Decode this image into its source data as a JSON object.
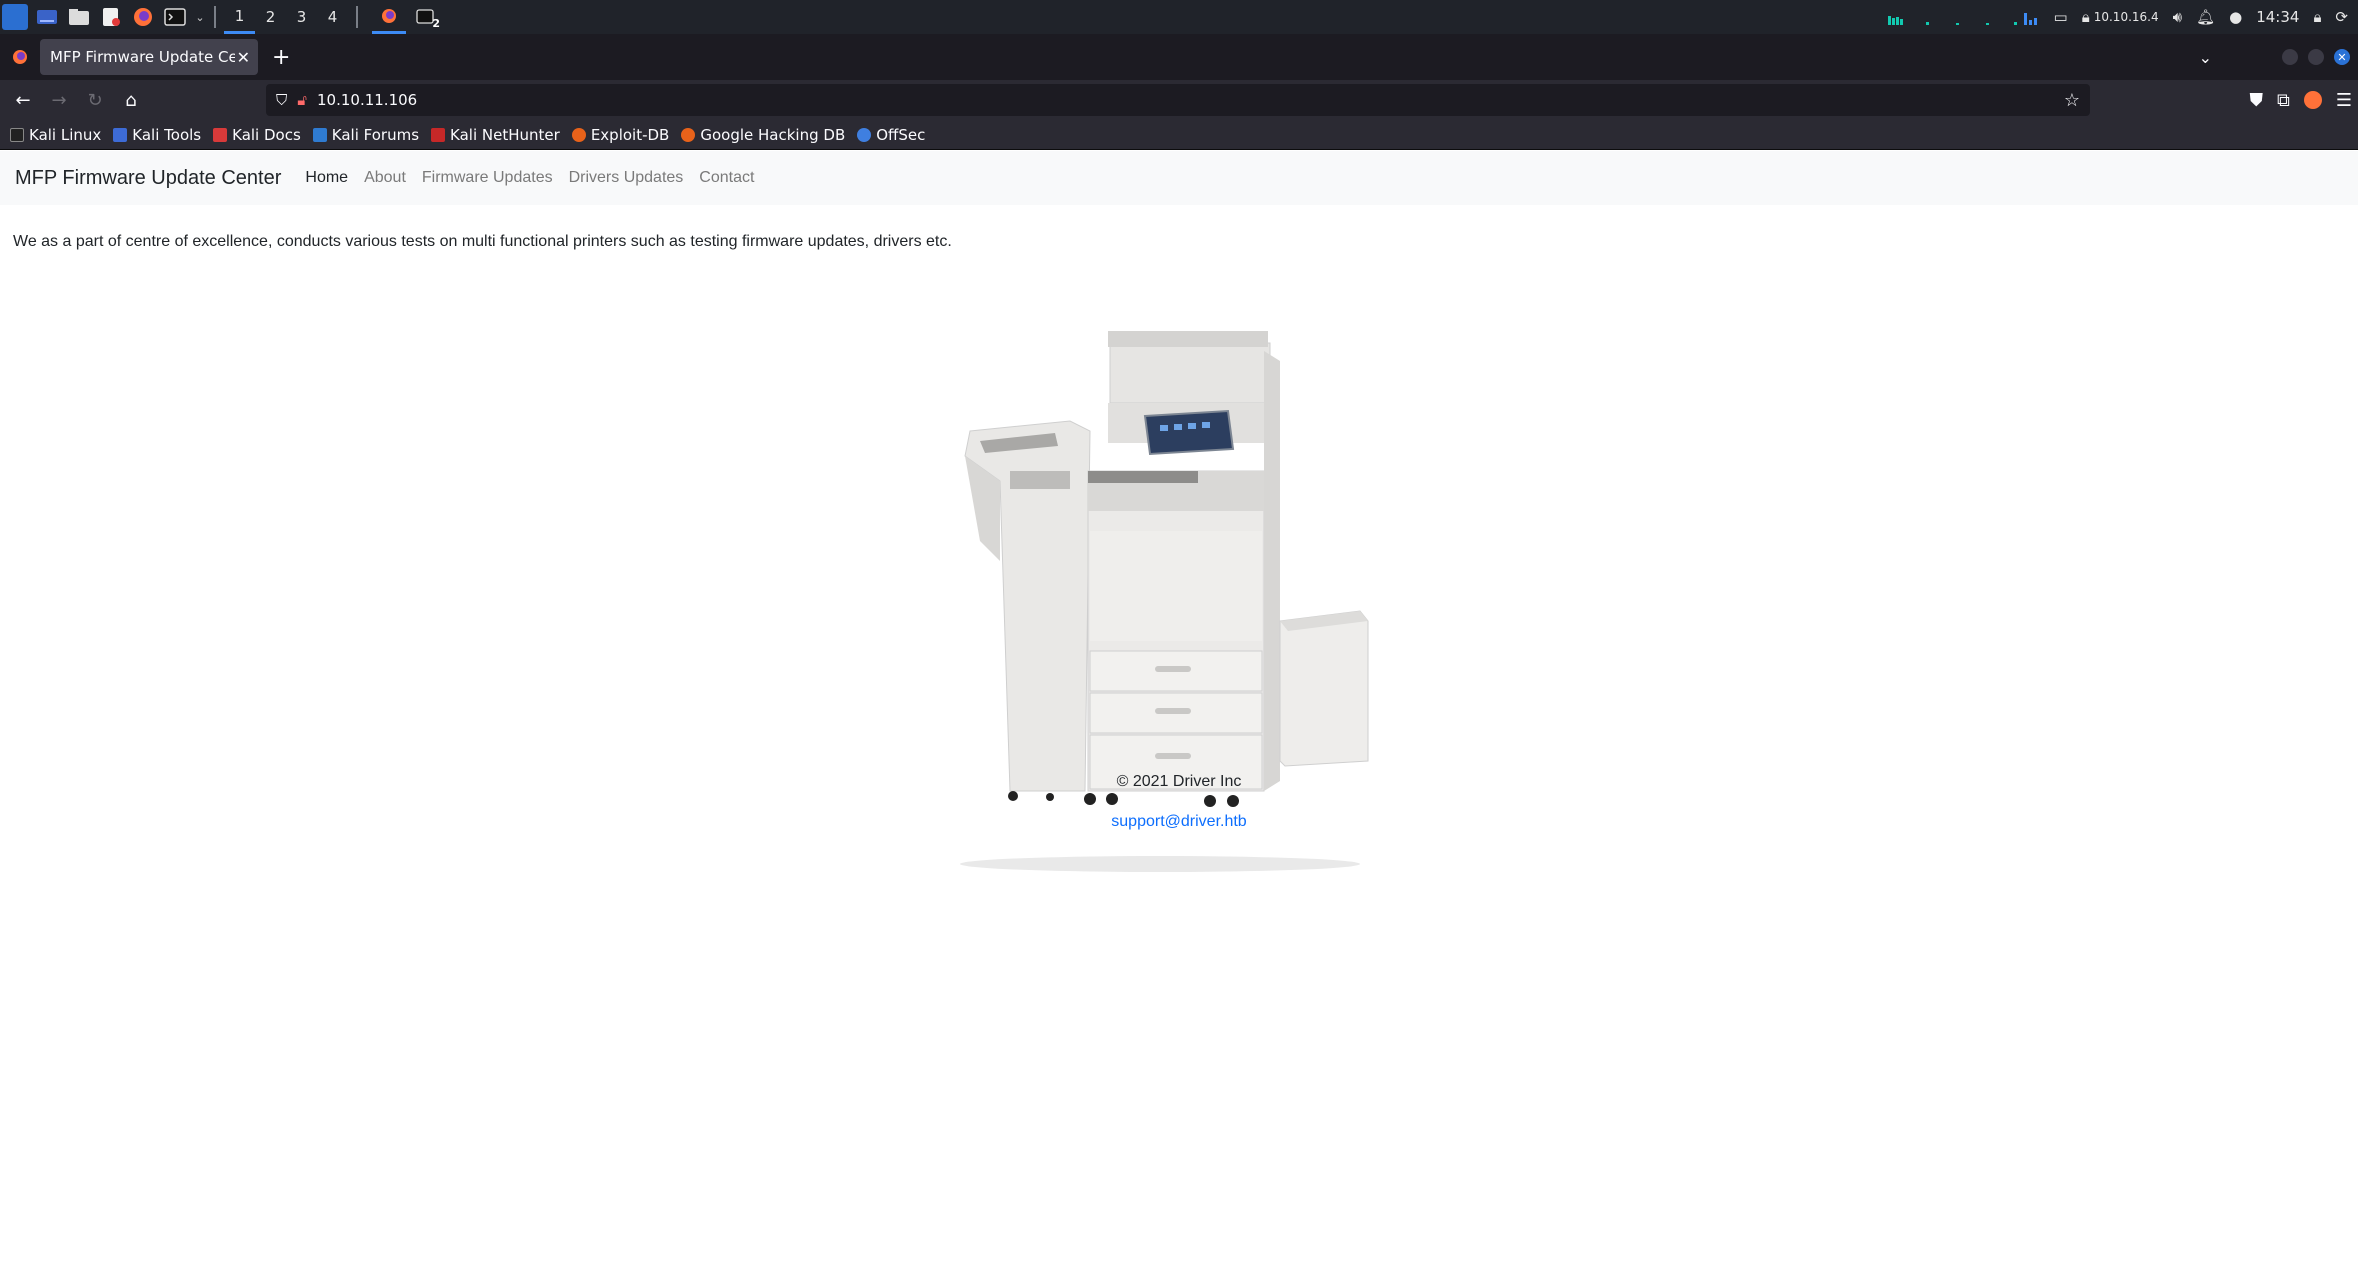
{
  "taskbar": {
    "workspaces": [
      "1",
      "2",
      "3",
      "4"
    ],
    "terminal_badge": "2",
    "ip": "10.10.16.4",
    "clock": "14:34"
  },
  "browser": {
    "tab_title": "MFP Firmware Update Center",
    "url": "10.10.11.106",
    "bookmarks": [
      "Kali Linux",
      "Kali Tools",
      "Kali Docs",
      "Kali Forums",
      "Kali NetHunter",
      "Exploit-DB",
      "Google Hacking DB",
      "OffSec"
    ]
  },
  "site": {
    "brand": "MFP Firmware Update Center",
    "nav": [
      "Home",
      "About",
      "Firmware Updates",
      "Drivers Updates",
      "Contact"
    ],
    "intro": "We as a part of centre of excellence, conducts various tests on multi functional printers such as testing firmware updates, drivers etc.",
    "copyright": "© 2021 Driver Inc",
    "email": "support@driver.htb"
  },
  "colors": {
    "link": "#0d6efd",
    "taskbar_bg": "#20232a",
    "accent": "#3d8bf5"
  }
}
